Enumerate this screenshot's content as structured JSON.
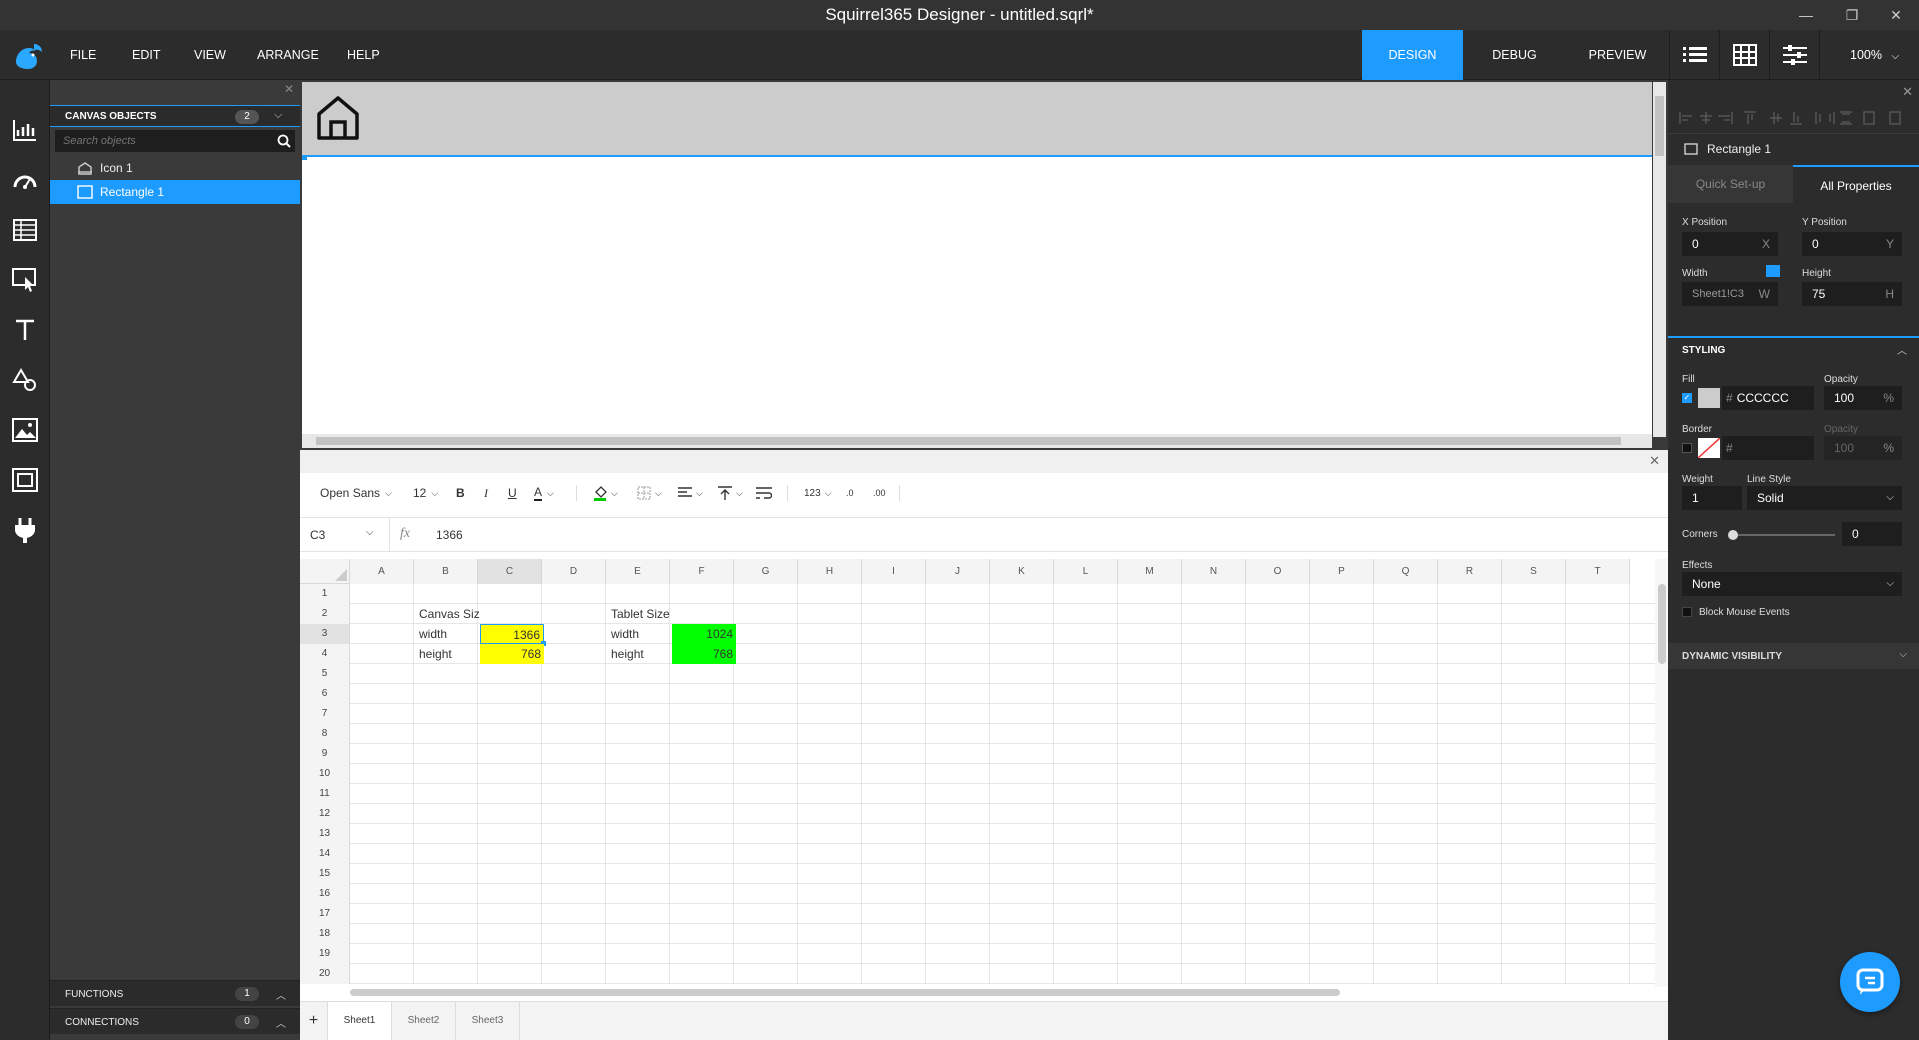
{
  "window": {
    "title": "Squirrel365 Designer - untitled.sqrl*"
  },
  "menu": {
    "items": [
      "FILE",
      "EDIT",
      "VIEW",
      "ARRANGE",
      "HELP"
    ]
  },
  "modes": {
    "design": "DESIGN",
    "debug": "DEBUG",
    "preview": "PREVIEW",
    "zoom": "100%"
  },
  "objects": {
    "header": "CANVAS OBJECTS",
    "count": "2",
    "search_placeholder": "Search objects",
    "items": [
      {
        "label": "Icon 1",
        "icon": "icon-object-icon"
      },
      {
        "label": "Rectangle 1",
        "icon": "rectangle-icon"
      }
    ],
    "functions_label": "FUNCTIONS",
    "functions_count": "1",
    "connections_label": "CONNECTIONS",
    "connections_count": "0"
  },
  "props": {
    "selected": "Rectangle 1",
    "tab_quick": "Quick Set-up",
    "tab_all": "All Properties",
    "x_label": "X Position",
    "x_value": "0",
    "x_suffix": "X",
    "y_label": "Y Position",
    "y_value": "0",
    "y_suffix": "Y",
    "w_label": "Width",
    "w_value": "Sheet1!C3",
    "w_suffix": "W",
    "h_label": "Height",
    "h_value": "75",
    "h_suffix": "H",
    "styling": "STYLING",
    "fill_label": "Fill",
    "fill_hash": "#",
    "fill_value": "CCCCCC",
    "opacity_label": "Opacity",
    "opacity_value": "100",
    "opacity_suffix": "%",
    "border_label": "Border",
    "border_hash": "#",
    "border_opacity_label": "Opacity",
    "border_opacity_value": "100",
    "border_opacity_suffix": "%",
    "weight_label": "Weight",
    "weight_value": "1",
    "linestyle_label": "Line Style",
    "linestyle_value": "Solid",
    "corners_label": "Corners",
    "corners_value": "0",
    "effects_label": "Effects",
    "effects_value": "None",
    "block_mouse": "Block Mouse Events",
    "dynamic": "DYNAMIC VISIBILITY"
  },
  "toolbar": {
    "font": "Open Sans",
    "size": "12",
    "bold": "B",
    "italic": "I",
    "underline": "U",
    "font_color": "A",
    "number_format": "123"
  },
  "formula": {
    "cell_ref": "C3",
    "fx": "fx",
    "value": "1366"
  },
  "sheet": {
    "columns": [
      "A",
      "B",
      "C",
      "D",
      "E",
      "F",
      "G",
      "H",
      "I",
      "J",
      "K",
      "L",
      "M",
      "N",
      "O",
      "P",
      "Q",
      "R",
      "S",
      "T"
    ],
    "rows": [
      "1",
      "2",
      "3",
      "4",
      "5",
      "6",
      "7",
      "8",
      "9",
      "10",
      "11",
      "12",
      "13",
      "14",
      "15",
      "16",
      "17",
      "18",
      "19",
      "20"
    ],
    "b2": "Canvas Size",
    "b3": "width",
    "c3": "1366",
    "b4": "height",
    "c4": "768",
    "e2": "Tablet Size",
    "e3": "width",
    "f3": "1024",
    "e4": "height",
    "f4": "768",
    "tabs": [
      "Sheet1",
      "Sheet2",
      "Sheet3"
    ],
    "add_tab": "+"
  },
  "colors": {
    "accent": "#1e9bff",
    "yellow": "#ffff00",
    "green": "#00ff00",
    "rect_fill": "#cccccc"
  }
}
